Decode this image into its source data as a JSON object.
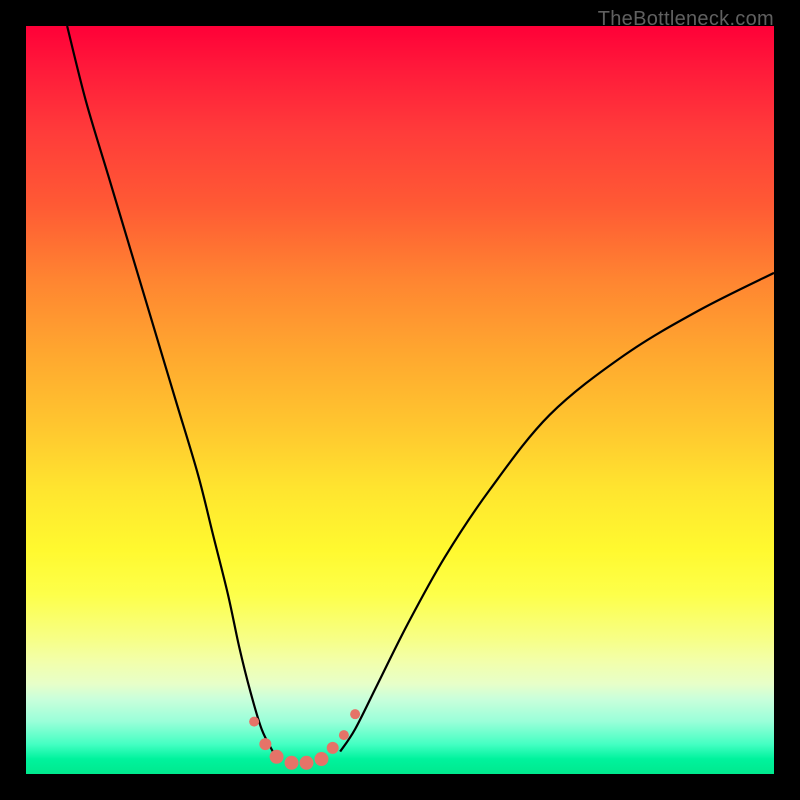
{
  "watermark": "TheBottleneck.com",
  "chart_data": {
    "type": "line",
    "title": "",
    "xlabel": "",
    "ylabel": "",
    "xlim": [
      0,
      100
    ],
    "ylim": [
      0,
      100
    ],
    "grid": false,
    "series": [
      {
        "name": "left-branch",
        "x": [
          5.5,
          8,
          11,
          14,
          17,
          20,
          23,
          25,
          27,
          28.5,
          30,
          31.5,
          33
        ],
        "values": [
          100,
          90,
          80,
          70,
          60,
          50,
          40,
          32,
          24,
          17,
          11,
          6,
          3
        ]
      },
      {
        "name": "right-branch",
        "x": [
          42,
          44,
          47,
          51,
          56,
          62,
          70,
          80,
          90,
          100
        ],
        "values": [
          3,
          6,
          12,
          20,
          29,
          38,
          48,
          56,
          62,
          67
        ]
      }
    ],
    "markers": [
      {
        "name": "dot",
        "x": 30.5,
        "y": 7,
        "r": 5
      },
      {
        "name": "dot",
        "x": 32.0,
        "y": 4,
        "r": 6
      },
      {
        "name": "dot",
        "x": 33.5,
        "y": 2.3,
        "r": 7
      },
      {
        "name": "dot",
        "x": 35.5,
        "y": 1.5,
        "r": 7
      },
      {
        "name": "dot",
        "x": 37.5,
        "y": 1.5,
        "r": 7
      },
      {
        "name": "dot",
        "x": 39.5,
        "y": 2.0,
        "r": 7
      },
      {
        "name": "dot",
        "x": 41.0,
        "y": 3.5,
        "r": 6
      },
      {
        "name": "dot",
        "x": 42.5,
        "y": 5.2,
        "r": 5
      },
      {
        "name": "dot",
        "x": 44.0,
        "y": 8,
        "r": 5
      }
    ],
    "marker_color": "#e57368",
    "curve_color": "#000000",
    "background_gradient": {
      "top": "#ff0038",
      "mid": "#fff92f",
      "bottom": "#00e98e"
    }
  }
}
